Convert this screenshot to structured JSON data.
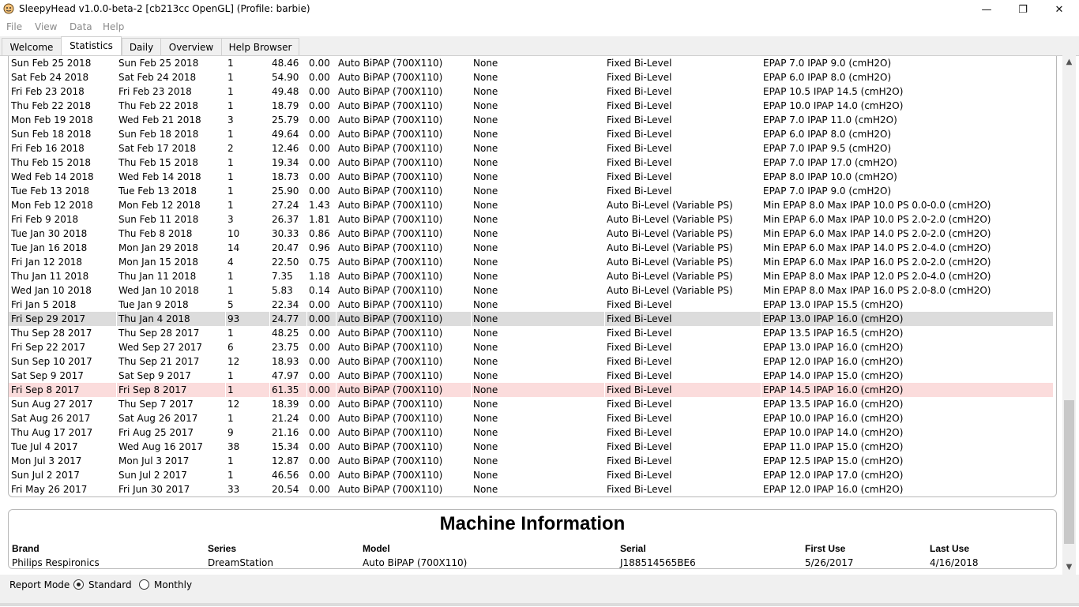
{
  "window": {
    "title": "SleepyHead v1.0.0-beta-2 [cb213cc OpenGL] (Profile: barbie)",
    "minimize_glyph": "—",
    "restore_glyph": "❐",
    "close_glyph": "✕"
  },
  "menu": [
    "File",
    "View",
    "Data",
    "Help"
  ],
  "tabs": [
    {
      "label": "Welcome",
      "active": false
    },
    {
      "label": "Statistics",
      "active": true
    },
    {
      "label": "Daily",
      "active": false
    },
    {
      "label": "Overview",
      "active": false
    },
    {
      "label": "Help Browser",
      "active": false
    }
  ],
  "rows": [
    {
      "start": "Sun Feb 25 2018",
      "end": "Sun Feb 25 2018",
      "days": "1",
      "median": "48.46",
      "ahi": "0.00",
      "machine": "Auto BiPAP (700X110)",
      "humid": "None",
      "mode": "Fixed Bi-Level",
      "pressure": "EPAP 7.0 IPAP 9.0 (cmH2O)",
      "hl": ""
    },
    {
      "start": "Sat Feb 24 2018",
      "end": "Sat Feb 24 2018",
      "days": "1",
      "median": "54.90",
      "ahi": "0.00",
      "machine": "Auto BiPAP (700X110)",
      "humid": "None",
      "mode": "Fixed Bi-Level",
      "pressure": "EPAP 6.0 IPAP 8.0 (cmH2O)",
      "hl": ""
    },
    {
      "start": "Fri Feb 23 2018",
      "end": "Fri Feb 23 2018",
      "days": "1",
      "median": "49.48",
      "ahi": "0.00",
      "machine": "Auto BiPAP (700X110)",
      "humid": "None",
      "mode": "Fixed Bi-Level",
      "pressure": "EPAP 10.5 IPAP 14.5 (cmH2O)",
      "hl": ""
    },
    {
      "start": "Thu Feb 22 2018",
      "end": "Thu Feb 22 2018",
      "days": "1",
      "median": "18.79",
      "ahi": "0.00",
      "machine": "Auto BiPAP (700X110)",
      "humid": "None",
      "mode": "Fixed Bi-Level",
      "pressure": "EPAP 10.0 IPAP 14.0 (cmH2O)",
      "hl": ""
    },
    {
      "start": "Mon Feb 19 2018",
      "end": "Wed Feb 21 2018",
      "days": "3",
      "median": "25.79",
      "ahi": "0.00",
      "machine": "Auto BiPAP (700X110)",
      "humid": "None",
      "mode": "Fixed Bi-Level",
      "pressure": "EPAP 7.0 IPAP 11.0 (cmH2O)",
      "hl": ""
    },
    {
      "start": "Sun Feb 18 2018",
      "end": "Sun Feb 18 2018",
      "days": "1",
      "median": "49.64",
      "ahi": "0.00",
      "machine": "Auto BiPAP (700X110)",
      "humid": "None",
      "mode": "Fixed Bi-Level",
      "pressure": "EPAP 6.0 IPAP 8.0 (cmH2O)",
      "hl": ""
    },
    {
      "start": "Fri Feb 16 2018",
      "end": "Sat Feb 17 2018",
      "days": "2",
      "median": "12.46",
      "ahi": "0.00",
      "machine": "Auto BiPAP (700X110)",
      "humid": "None",
      "mode": "Fixed Bi-Level",
      "pressure": "EPAP 7.0 IPAP 9.5 (cmH2O)",
      "hl": ""
    },
    {
      "start": "Thu Feb 15 2018",
      "end": "Thu Feb 15 2018",
      "days": "1",
      "median": "19.34",
      "ahi": "0.00",
      "machine": "Auto BiPAP (700X110)",
      "humid": "None",
      "mode": "Fixed Bi-Level",
      "pressure": "EPAP 7.0 IPAP 17.0 (cmH2O)",
      "hl": ""
    },
    {
      "start": "Wed Feb 14 2018",
      "end": "Wed Feb 14 2018",
      "days": "1",
      "median": "18.73",
      "ahi": "0.00",
      "machine": "Auto BiPAP (700X110)",
      "humid": "None",
      "mode": "Fixed Bi-Level",
      "pressure": "EPAP 8.0 IPAP 10.0 (cmH2O)",
      "hl": ""
    },
    {
      "start": "Tue Feb 13 2018",
      "end": "Tue Feb 13 2018",
      "days": "1",
      "median": "25.90",
      "ahi": "0.00",
      "machine": "Auto BiPAP (700X110)",
      "humid": "None",
      "mode": "Fixed Bi-Level",
      "pressure": "EPAP 7.0 IPAP 9.0 (cmH2O)",
      "hl": ""
    },
    {
      "start": "Mon Feb 12 2018",
      "end": "Mon Feb 12 2018",
      "days": "1",
      "median": "27.24",
      "ahi": "1.43",
      "machine": "Auto BiPAP (700X110)",
      "humid": "None",
      "mode": "Auto Bi-Level (Variable PS)",
      "pressure": "Min EPAP 8.0 Max IPAP 10.0 PS 0.0-0.0 (cmH2O)",
      "hl": ""
    },
    {
      "start": "Fri Feb 9 2018",
      "end": "Sun Feb 11 2018",
      "days": "3",
      "median": "26.37",
      "ahi": "1.81",
      "machine": "Auto BiPAP (700X110)",
      "humid": "None",
      "mode": "Auto Bi-Level (Variable PS)",
      "pressure": "Min EPAP 6.0 Max IPAP 10.0 PS 2.0-2.0 (cmH2O)",
      "hl": ""
    },
    {
      "start": "Tue Jan 30 2018",
      "end": "Thu Feb 8 2018",
      "days": "10",
      "median": "30.33",
      "ahi": "0.86",
      "machine": "Auto BiPAP (700X110)",
      "humid": "None",
      "mode": "Auto Bi-Level (Variable PS)",
      "pressure": "Min EPAP 6.0 Max IPAP 14.0 PS 2.0-2.0 (cmH2O)",
      "hl": ""
    },
    {
      "start": "Tue Jan 16 2018",
      "end": "Mon Jan 29 2018",
      "days": "14",
      "median": "20.47",
      "ahi": "0.96",
      "machine": "Auto BiPAP (700X110)",
      "humid": "None",
      "mode": "Auto Bi-Level (Variable PS)",
      "pressure": "Min EPAP 6.0 Max IPAP 14.0 PS 2.0-4.0 (cmH2O)",
      "hl": ""
    },
    {
      "start": "Fri Jan 12 2018",
      "end": "Mon Jan 15 2018",
      "days": "4",
      "median": "22.50",
      "ahi": "0.75",
      "machine": "Auto BiPAP (700X110)",
      "humid": "None",
      "mode": "Auto Bi-Level (Variable PS)",
      "pressure": "Min EPAP 6.0 Max IPAP 16.0 PS 2.0-2.0 (cmH2O)",
      "hl": ""
    },
    {
      "start": "Thu Jan 11 2018",
      "end": "Thu Jan 11 2018",
      "days": "1",
      "median": "7.35",
      "ahi": "1.18",
      "machine": "Auto BiPAP (700X110)",
      "humid": "None",
      "mode": "Auto Bi-Level (Variable PS)",
      "pressure": "Min EPAP 8.0 Max IPAP 12.0 PS 2.0-4.0 (cmH2O)",
      "hl": ""
    },
    {
      "start": "Wed Jan 10 2018",
      "end": "Wed Jan 10 2018",
      "days": "1",
      "median": "5.83",
      "ahi": "0.14",
      "machine": "Auto BiPAP (700X110)",
      "humid": "None",
      "mode": "Auto Bi-Level (Variable PS)",
      "pressure": "Min EPAP 8.0 Max IPAP 16.0 PS 2.0-8.0 (cmH2O)",
      "hl": ""
    },
    {
      "start": "Fri Jan 5 2018",
      "end": "Tue Jan 9 2018",
      "days": "5",
      "median": "22.34",
      "ahi": "0.00",
      "machine": "Auto BiPAP (700X110)",
      "humid": "None",
      "mode": "Fixed Bi-Level",
      "pressure": "EPAP 13.0 IPAP 15.5 (cmH2O)",
      "hl": ""
    },
    {
      "start": "Fri Sep 29 2017",
      "end": "Thu Jan 4 2018",
      "days": "93",
      "median": "24.77",
      "ahi": "0.00",
      "machine": "Auto BiPAP (700X110)",
      "humid": "None",
      "mode": "Fixed Bi-Level",
      "pressure": "EPAP 13.0 IPAP 16.0 (cmH2O)",
      "hl": "gray"
    },
    {
      "start": "Thu Sep 28 2017",
      "end": "Thu Sep 28 2017",
      "days": "1",
      "median": "48.25",
      "ahi": "0.00",
      "machine": "Auto BiPAP (700X110)",
      "humid": "None",
      "mode": "Fixed Bi-Level",
      "pressure": "EPAP 13.5 IPAP 16.5 (cmH2O)",
      "hl": ""
    },
    {
      "start": "Fri Sep 22 2017",
      "end": "Wed Sep 27 2017",
      "days": "6",
      "median": "23.75",
      "ahi": "0.00",
      "machine": "Auto BiPAP (700X110)",
      "humid": "None",
      "mode": "Fixed Bi-Level",
      "pressure": "EPAP 13.0 IPAP 16.0 (cmH2O)",
      "hl": ""
    },
    {
      "start": "Sun Sep 10 2017",
      "end": "Thu Sep 21 2017",
      "days": "12",
      "median": "18.93",
      "ahi": "0.00",
      "machine": "Auto BiPAP (700X110)",
      "humid": "None",
      "mode": "Fixed Bi-Level",
      "pressure": "EPAP 12.0 IPAP 16.0 (cmH2O)",
      "hl": ""
    },
    {
      "start": "Sat Sep 9 2017",
      "end": "Sat Sep 9 2017",
      "days": "1",
      "median": "47.97",
      "ahi": "0.00",
      "machine": "Auto BiPAP (700X110)",
      "humid": "None",
      "mode": "Fixed Bi-Level",
      "pressure": "EPAP 14.0 IPAP 15.0 (cmH2O)",
      "hl": ""
    },
    {
      "start": "Fri Sep 8 2017",
      "end": "Fri Sep 8 2017",
      "days": "1",
      "median": "61.35",
      "ahi": "0.00",
      "machine": "Auto BiPAP (700X110)",
      "humid": "None",
      "mode": "Fixed Bi-Level",
      "pressure": "EPAP 14.5 IPAP 16.0 (cmH2O)",
      "hl": "pink"
    },
    {
      "start": "Sun Aug 27 2017",
      "end": "Thu Sep 7 2017",
      "days": "12",
      "median": "18.39",
      "ahi": "0.00",
      "machine": "Auto BiPAP (700X110)",
      "humid": "None",
      "mode": "Fixed Bi-Level",
      "pressure": "EPAP 13.5 IPAP 16.0 (cmH2O)",
      "hl": ""
    },
    {
      "start": "Sat Aug 26 2017",
      "end": "Sat Aug 26 2017",
      "days": "1",
      "median": "21.24",
      "ahi": "0.00",
      "machine": "Auto BiPAP (700X110)",
      "humid": "None",
      "mode": "Fixed Bi-Level",
      "pressure": "EPAP 10.0 IPAP 16.0 (cmH2O)",
      "hl": ""
    },
    {
      "start": "Thu Aug 17 2017",
      "end": "Fri Aug 25 2017",
      "days": "9",
      "median": "21.16",
      "ahi": "0.00",
      "machine": "Auto BiPAP (700X110)",
      "humid": "None",
      "mode": "Fixed Bi-Level",
      "pressure": "EPAP 10.0 IPAP 14.0 (cmH2O)",
      "hl": ""
    },
    {
      "start": "Tue Jul 4 2017",
      "end": "Wed Aug 16 2017",
      "days": "38",
      "median": "15.34",
      "ahi": "0.00",
      "machine": "Auto BiPAP (700X110)",
      "humid": "None",
      "mode": "Fixed Bi-Level",
      "pressure": "EPAP 11.0 IPAP 15.0 (cmH2O)",
      "hl": ""
    },
    {
      "start": "Mon Jul 3 2017",
      "end": "Mon Jul 3 2017",
      "days": "1",
      "median": "12.87",
      "ahi": "0.00",
      "machine": "Auto BiPAP (700X110)",
      "humid": "None",
      "mode": "Fixed Bi-Level",
      "pressure": "EPAP 12.5 IPAP 15.0 (cmH2O)",
      "hl": ""
    },
    {
      "start": "Sun Jul 2 2017",
      "end": "Sun Jul 2 2017",
      "days": "1",
      "median": "46.56",
      "ahi": "0.00",
      "machine": "Auto BiPAP (700X110)",
      "humid": "None",
      "mode": "Fixed Bi-Level",
      "pressure": "EPAP 12.0 IPAP 17.0 (cmH2O)",
      "hl": ""
    },
    {
      "start": "Fri May 26 2017",
      "end": "Fri Jun 30 2017",
      "days": "33",
      "median": "20.54",
      "ahi": "0.00",
      "machine": "Auto BiPAP (700X110)",
      "humid": "None",
      "mode": "Fixed Bi-Level",
      "pressure": "EPAP 12.0 IPAP 16.0 (cmH2O)",
      "hl": ""
    }
  ],
  "machine_info": {
    "title": "Machine Information",
    "headers": {
      "brand": "Brand",
      "series": "Series",
      "model": "Model",
      "serial": "Serial",
      "first_use": "First Use",
      "last_use": "Last Use"
    },
    "values": {
      "brand": "Philips Respironics",
      "series": "DreamStation",
      "model": "Auto BiPAP (700X110)",
      "serial": "J188514565BE6",
      "first_use": "5/26/2017",
      "last_use": "4/16/2018"
    }
  },
  "report_mode": {
    "label": "Report Mode",
    "options": [
      {
        "label": "Standard",
        "selected": true
      },
      {
        "label": "Monthly",
        "selected": false
      }
    ]
  },
  "colors": {
    "row_gray": "#dcdcdc",
    "row_pink": "#fbdcdc"
  }
}
